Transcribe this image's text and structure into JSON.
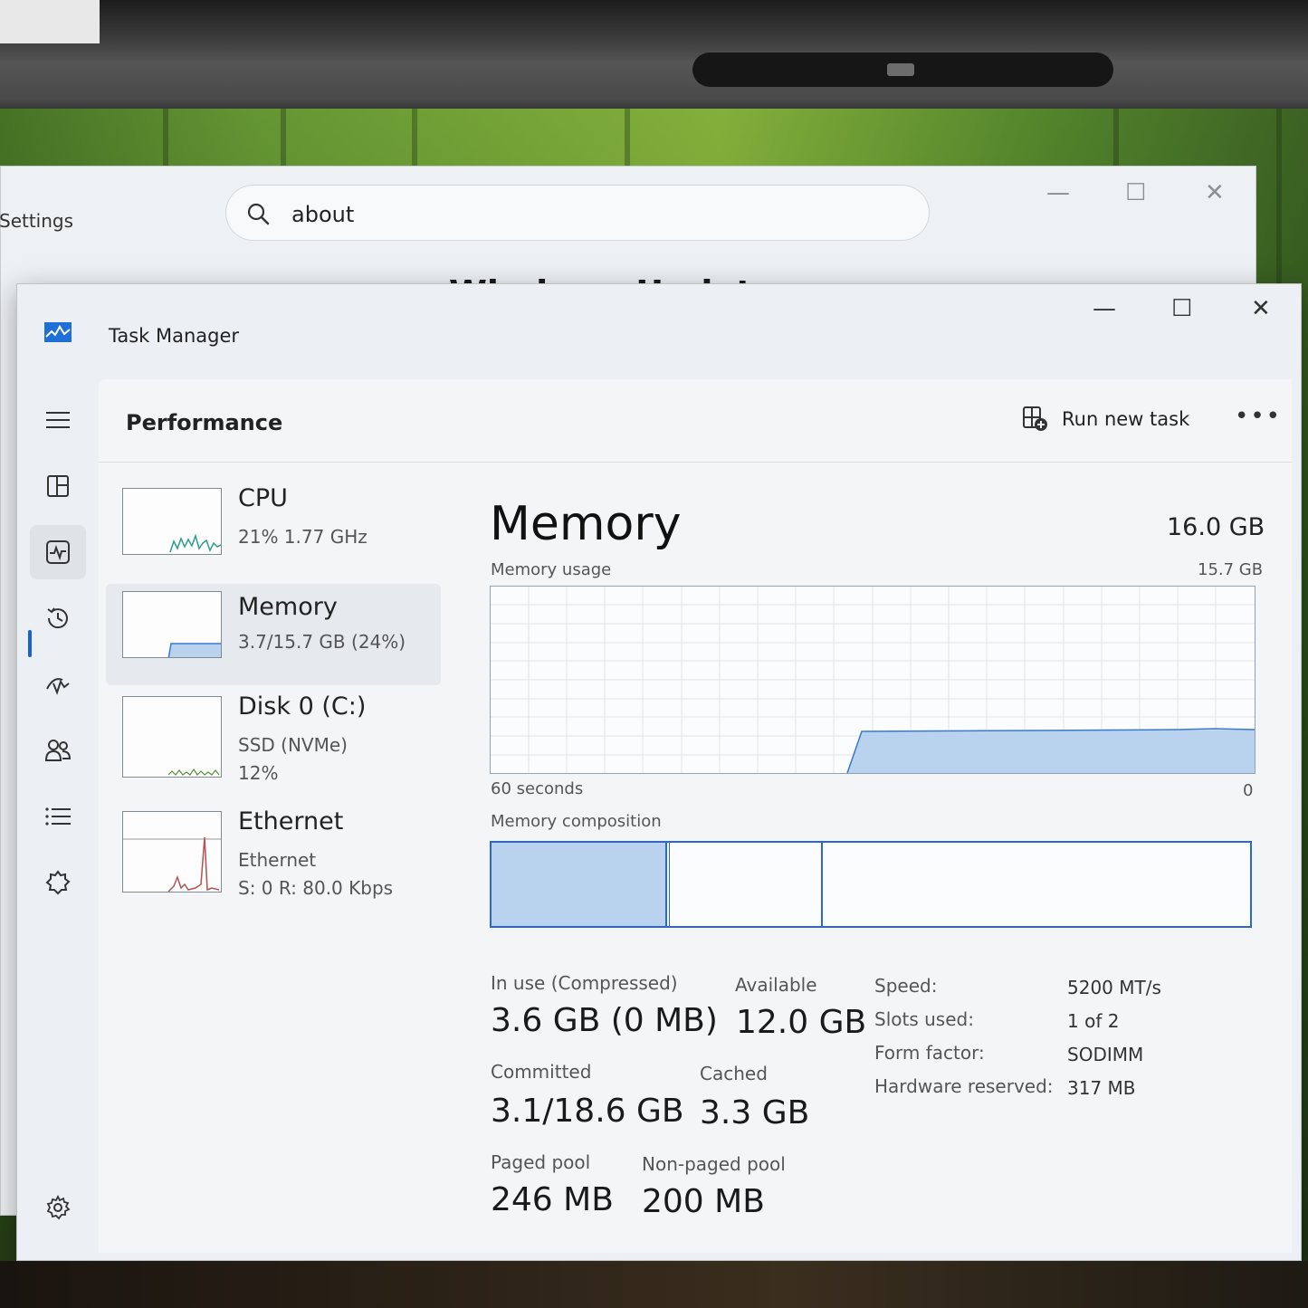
{
  "settings": {
    "title": "Settings",
    "search_value": "about",
    "heading": "Windows Update"
  },
  "task_manager": {
    "title": "Task Manager",
    "page_title": "Performance",
    "run_new_task": "Run new task",
    "more": "•••",
    "window_controls": {
      "minimize": "—",
      "maximize": "☐",
      "close": "✕"
    }
  },
  "nav": [
    "hamburger-icon",
    "processes-icon",
    "performance-icon",
    "app-history-icon",
    "startup-apps-icon",
    "users-icon",
    "details-icon",
    "services-icon",
    "settings-icon"
  ],
  "resources": [
    {
      "name": "CPU",
      "line1": "21%  1.77 GHz",
      "line2": ""
    },
    {
      "name": "Memory",
      "line1": "3.7/15.7 GB (24%)",
      "line2": ""
    },
    {
      "name": "Disk 0 (C:)",
      "line1": "SSD (NVMe)",
      "line2": "12%"
    },
    {
      "name": "Ethernet",
      "line1": "Ethernet",
      "line2": "S: 0  R: 80.0 Kbps"
    }
  ],
  "memory": {
    "title": "Memory",
    "total": "16.0 GB",
    "usage_label": "Memory usage",
    "usage_max": "15.7 GB",
    "time_left": "60 seconds",
    "time_right": "0",
    "composition_label": "Memory composition",
    "stats": {
      "in_use_label": "In use (Compressed)",
      "in_use_value": "3.6 GB (0 MB)",
      "available_label": "Available",
      "available_value": "12.0 GB",
      "committed_label": "Committed",
      "committed_value": "3.1/18.6 GB",
      "cached_label": "Cached",
      "cached_value": "3.3 GB",
      "paged_label": "Paged pool",
      "paged_value": "246 MB",
      "nonpaged_label": "Non-paged pool",
      "nonpaged_value": "200 MB"
    },
    "specs": [
      {
        "label": "Speed:",
        "value": "5200 MT/s"
      },
      {
        "label": "Slots used:",
        "value": "1 of 2"
      },
      {
        "label": "Form factor:",
        "value": "SODIMM"
      },
      {
        "label": "Hardware reserved:",
        "value": "317 MB"
      }
    ]
  },
  "colors": {
    "graph_fill": "#b9d3ee",
    "graph_line": "#3b78d0",
    "accent": "#1c5fd0",
    "ethernet_line": "#b35050"
  }
}
